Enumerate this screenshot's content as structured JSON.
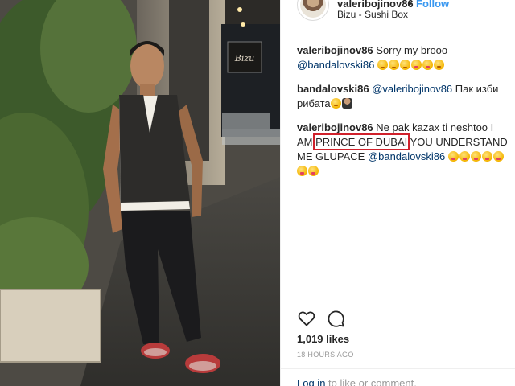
{
  "header": {
    "username": "valeribojinov86",
    "separator": "•",
    "follow_label": "Follow",
    "location": "Bizu - Sushi Box"
  },
  "photo": {
    "sign_text": "Bizu"
  },
  "comments": [
    {
      "user": "valeribojinov86",
      "text": "Sorry my brooo",
      "mention": "@bandalovski86"
    },
    {
      "user": "bandalovski86",
      "mention": "@valeribojinov86",
      "text": "Пак изби рибата"
    },
    {
      "user": "valeribojinov86",
      "text_before": "Ne pak kazax ti neshtoo I AM",
      "highlight": "PRINCE OF DUBAI",
      "text_after": "YOU UNDERSTAND ME GLUPACE",
      "mention": "@bandalovski86"
    }
  ],
  "actions": {
    "like_icon": "heart-icon",
    "comment_icon": "comment-bubble-icon"
  },
  "likes": "1,019 likes",
  "time_ago": "18 HOURS AGO",
  "login": {
    "link": "Log in",
    "rest": "to like or comment."
  },
  "colors": {
    "accent_blue": "#3897f0",
    "mention_blue": "#003569",
    "highlight_red": "#d0212b"
  }
}
